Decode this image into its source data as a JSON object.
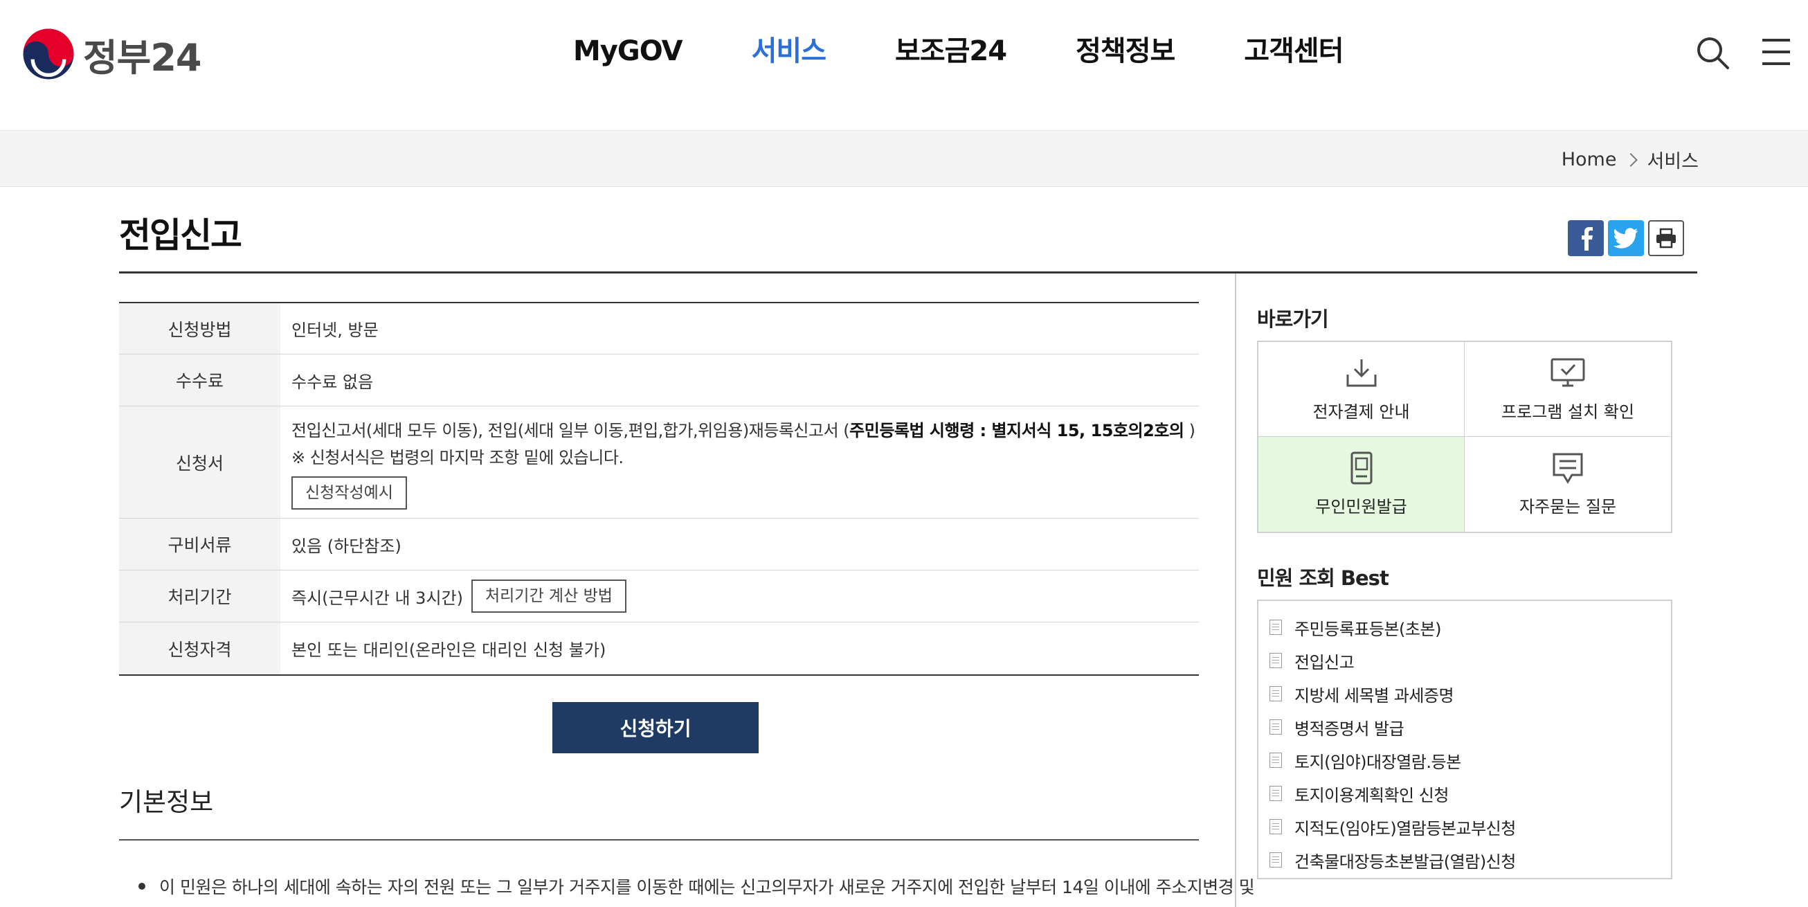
{
  "header": {
    "logo_text": "정부24",
    "nav": [
      {
        "label": "MyGOV",
        "active": false
      },
      {
        "label": "서비스",
        "active": true
      },
      {
        "label": "보조금24",
        "active": false
      },
      {
        "label": "정책정보",
        "active": false
      },
      {
        "label": "고객센터",
        "active": false
      }
    ]
  },
  "breadcrumb": [
    "Home",
    "서비스"
  ],
  "page": {
    "title": "전입신고"
  },
  "info_table": {
    "method": {
      "label": "신청방법",
      "value": "인터넷, 방문"
    },
    "fee": {
      "label": "수수료",
      "value": "수수료 없음"
    },
    "form": {
      "label": "신청서",
      "line1_pre": "전입신고서(세대 모두 이동), 전입(세대 일부 이동,편입,합가,위임용)재등록신고서 (",
      "line1_bold": "주민등록법 시행령 : 별지서식 15, 15호의2호의",
      "line1_post": " )",
      "line2": "※ 신청서식은 법령의 마지막 조항 밑에 있습니다.",
      "example_button": "신청작성예시"
    },
    "docs": {
      "label": "구비서류",
      "value": "있음 (하단참조)"
    },
    "period": {
      "label": "처리기간",
      "value": "즉시(근무시간 내 3시간)",
      "calc_button": "처리기간 계산 방법"
    },
    "eligibility": {
      "label": "신청자격",
      "value": "본인 또는 대리인(온라인은 대리인 신청 불가)"
    }
  },
  "apply_button": "신청하기",
  "basic_info": {
    "title": "기본정보",
    "bullet": "이 민원은 하나의 세대에 속하는 자의 전원 또는 그 일부가 거주지를 이동한 때에는 신고의무자가 새로운 거주지에 전입한 날부터 14일 이내에 주소지변경 및"
  },
  "sidebar": {
    "quick_title": "바로가기",
    "quick": [
      {
        "label": "전자결제 안내",
        "icon": "download-icon",
        "highlight": false
      },
      {
        "label": "프로그램 설치 확인",
        "icon": "monitor-check-icon",
        "highlight": false
      },
      {
        "label": "무인민원발급",
        "icon": "kiosk-icon",
        "highlight": true
      },
      {
        "label": "자주묻는 질문",
        "icon": "chat-icon",
        "highlight": false
      }
    ],
    "best_title": "민원 조회 Best",
    "best": [
      "주민등록표등본(초본)",
      "전입신고",
      "지방세 세목별 과세증명",
      "병적증명서 발급",
      "토지(임야)대장열람.등본",
      "토지이용계획확인 신청",
      "지적도(임야도)열람등본교부신청",
      "건축물대장등초본발급(열람)신청"
    ]
  },
  "colors": {
    "accent": "#2b6fd8",
    "apply_button": "#1f3a63",
    "highlight_cell": "#e6f9e0",
    "facebook": "#3b5a98",
    "twitter": "#2aa3ef"
  }
}
